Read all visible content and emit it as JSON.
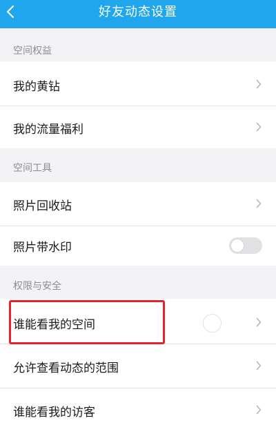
{
  "header": {
    "title": "好友动态设置",
    "back_icon": "back-arrow-icon",
    "background": "#1fa6ec"
  },
  "sections": [
    {
      "title": "空间权益",
      "items": [
        {
          "label": "我的黄钻",
          "control": "chevron"
        },
        {
          "label": "我的流量福利",
          "control": "chevron"
        }
      ]
    },
    {
      "title": "空间工具",
      "items": [
        {
          "label": "照片回收站",
          "control": "chevron"
        },
        {
          "label": "照片带水印",
          "control": "toggle",
          "toggle_on": false
        }
      ]
    },
    {
      "title": "权限与安全",
      "items": [
        {
          "label": "谁能看我的空间",
          "control": "chevron",
          "highlighted": true,
          "highlight_color": "#e8202a"
        },
        {
          "label": "允许查看动态的范围",
          "control": "chevron"
        },
        {
          "label": "谁能看我的访客",
          "control": "chevron"
        }
      ]
    }
  ]
}
